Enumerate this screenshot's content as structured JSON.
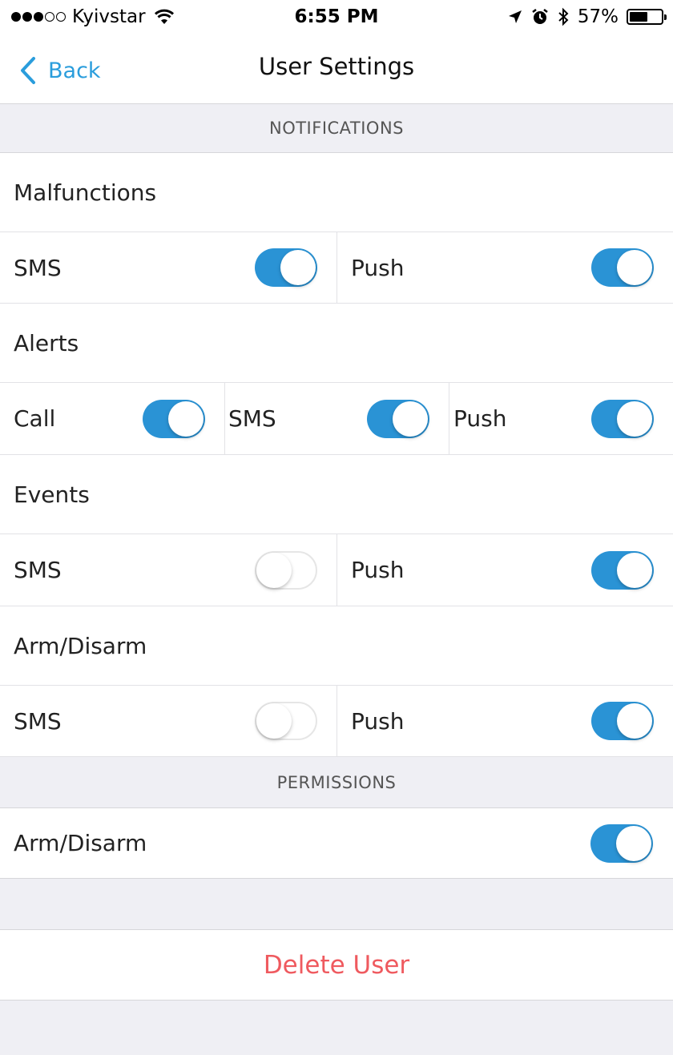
{
  "status_bar": {
    "carrier": "Kyivstar",
    "time": "6:55 PM",
    "battery_percent": "57%",
    "signal_strength": 3,
    "signal_max": 5
  },
  "nav": {
    "back_label": "Back",
    "title": "User Settings"
  },
  "colors": {
    "accent": "#2a93d5",
    "destructive": "#ef5a5f"
  },
  "notifications": {
    "header": "NOTIFICATIONS",
    "malfunctions": {
      "title": "Malfunctions",
      "sms_label": "SMS",
      "sms_on": true,
      "push_label": "Push",
      "push_on": true
    },
    "alerts": {
      "title": "Alerts",
      "call_label": "Call",
      "call_on": true,
      "sms_label": "SMS",
      "sms_on": true,
      "push_label": "Push",
      "push_on": true
    },
    "events": {
      "title": "Events",
      "sms_label": "SMS",
      "sms_on": false,
      "push_label": "Push",
      "push_on": true
    },
    "arm_disarm": {
      "title": "Arm/Disarm",
      "sms_label": "SMS",
      "sms_on": false,
      "push_label": "Push",
      "push_on": true
    }
  },
  "permissions": {
    "header": "PERMISSIONS",
    "arm_disarm_label": "Arm/Disarm",
    "arm_disarm_on": true
  },
  "delete_label": "Delete User"
}
